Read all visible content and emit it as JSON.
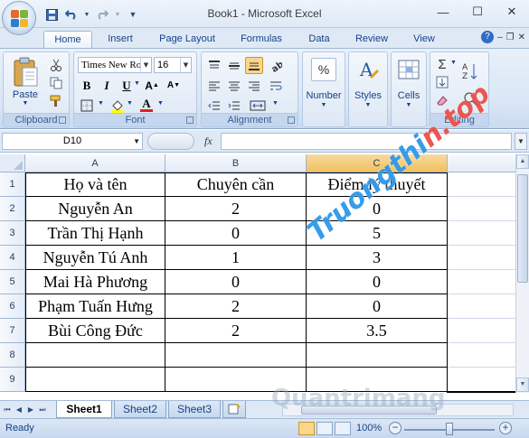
{
  "window": {
    "title": "Book1 - Microsoft Excel",
    "minimize": "—",
    "maximize": "☐",
    "close": "✕"
  },
  "qat": [
    "save-icon",
    "undo-icon",
    "redo-icon",
    "customize-icon"
  ],
  "tabs": [
    "Home",
    "Insert",
    "Page Layout",
    "Formulas",
    "Data",
    "Review",
    "View"
  ],
  "active_tab": "Home",
  "ribbon": {
    "clipboard": {
      "label": "Clipboard",
      "paste": "Paste"
    },
    "font": {
      "label": "Font",
      "name": "Times New Ro",
      "size": "16"
    },
    "alignment": {
      "label": "Alignment"
    },
    "number": {
      "label": "Number",
      "icon": "%"
    },
    "styles": {
      "label": "Styles"
    },
    "cells": {
      "label": "Cells"
    },
    "editing": {
      "label": "Editing",
      "sum_icon": "Σ"
    }
  },
  "formula_bar": {
    "name_box": "D10",
    "fx_label": "fx",
    "value": ""
  },
  "columns": [
    "A",
    "B",
    "C"
  ],
  "selected_column": "C",
  "rows": [
    "1",
    "2",
    "3",
    "4",
    "5",
    "6",
    "7",
    "8",
    "9"
  ],
  "table": {
    "headers": [
      "Họ và tên",
      "Chuyên cần",
      "Điểm lý thuyết"
    ],
    "body": [
      [
        "Nguyễn An",
        "2",
        "0"
      ],
      [
        "Trần Thị Hạnh",
        "0",
        "5"
      ],
      [
        "Nguyễn Tú Anh",
        "1",
        "3"
      ],
      [
        "Mai Hà Phương",
        "0",
        "0"
      ],
      [
        "Phạm Tuấn Hưng",
        "2",
        "0"
      ],
      [
        "Bùi Công Đức",
        "2",
        "3.5"
      ],
      [
        "",
        "",
        ""
      ],
      [
        "",
        "",
        ""
      ]
    ]
  },
  "sheets": [
    "Sheet1",
    "Sheet2",
    "Sheet3"
  ],
  "active_sheet": "Sheet1",
  "status": {
    "ready": "Ready",
    "zoom": "100%",
    "zoom_minus": "−",
    "zoom_plus": "+"
  },
  "watermarks": {
    "site_main": "Truongthi",
    "site_accent": "n.top",
    "bottom": "Quantrimang"
  },
  "colors": {
    "ribbon_text": "#15428b",
    "selected_column": "#f1c15f",
    "watermark_blue": "#148ce6",
    "watermark_red": "#e63c32"
  }
}
